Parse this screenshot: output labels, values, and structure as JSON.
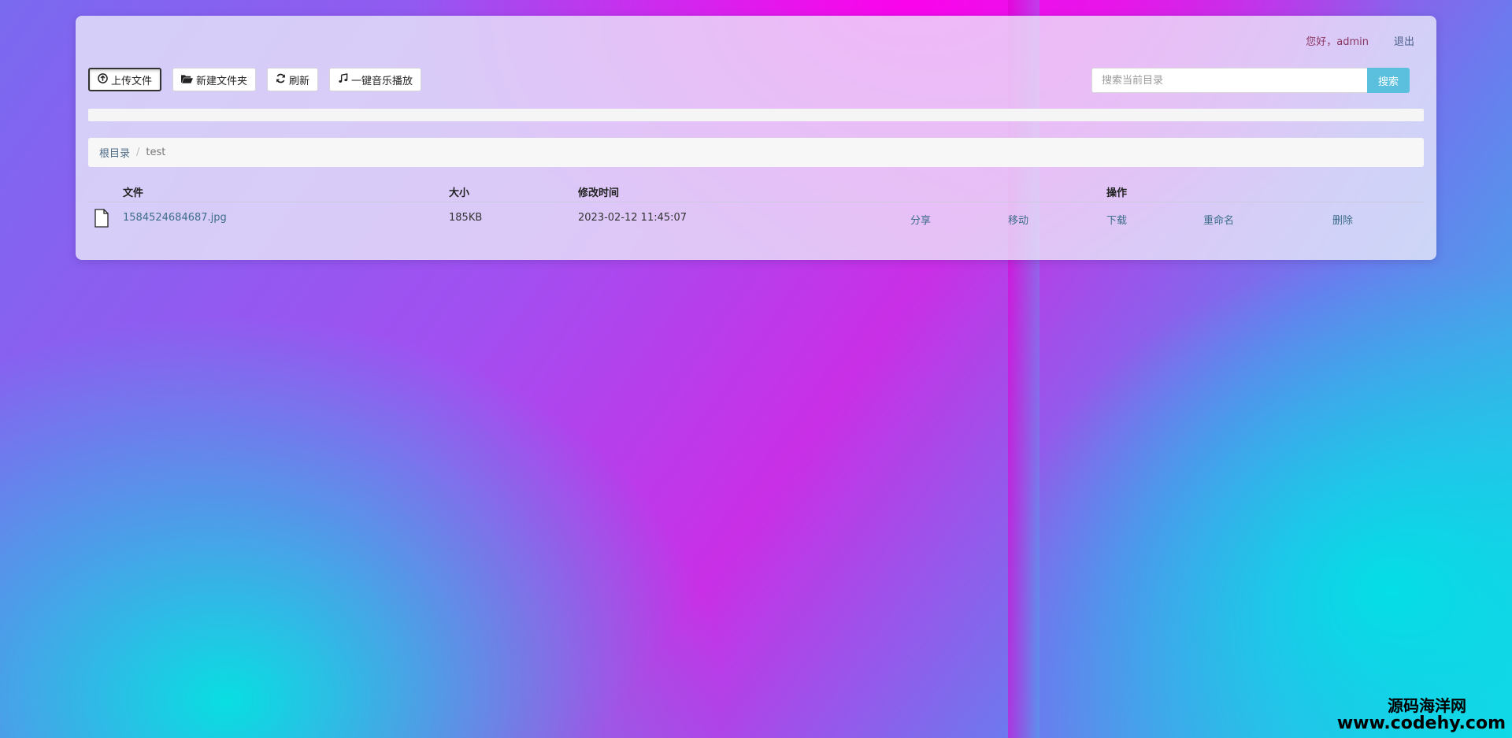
{
  "header": {
    "greeting": "您好，admin",
    "logout": "退出"
  },
  "toolbar": {
    "upload_label": "上传文件",
    "upload_icon": "arrow-circle-up-icon",
    "new_folder_label": "新建文件夹",
    "new_folder_icon": "folder-open-icon",
    "refresh_label": "刷新",
    "refresh_icon": "refresh-icon",
    "music_label": "一键音乐播放",
    "music_icon": "music-note-icon"
  },
  "search": {
    "placeholder": "搜索当前目录",
    "value": "",
    "button_label": "搜索"
  },
  "breadcrumb": {
    "root": "根目录",
    "separator": "/",
    "current": "test"
  },
  "table": {
    "headers": {
      "file": "文件",
      "size": "大小",
      "modified": "修改时间",
      "actions": "操作"
    },
    "rows": [
      {
        "name": "1584524684687.jpg",
        "size": "185KB",
        "modified": "2023-02-12 11:45:07",
        "share": "分享",
        "move": "移动",
        "download": "下载",
        "rename": "重命名",
        "delete": "删除"
      }
    ]
  },
  "watermark": {
    "name": "源码海洋网",
    "url": "www.codehy.com"
  },
  "colors": {
    "search_button": "#5bc0de",
    "link": "#3f6d8c",
    "greeting": "#8a3560"
  }
}
